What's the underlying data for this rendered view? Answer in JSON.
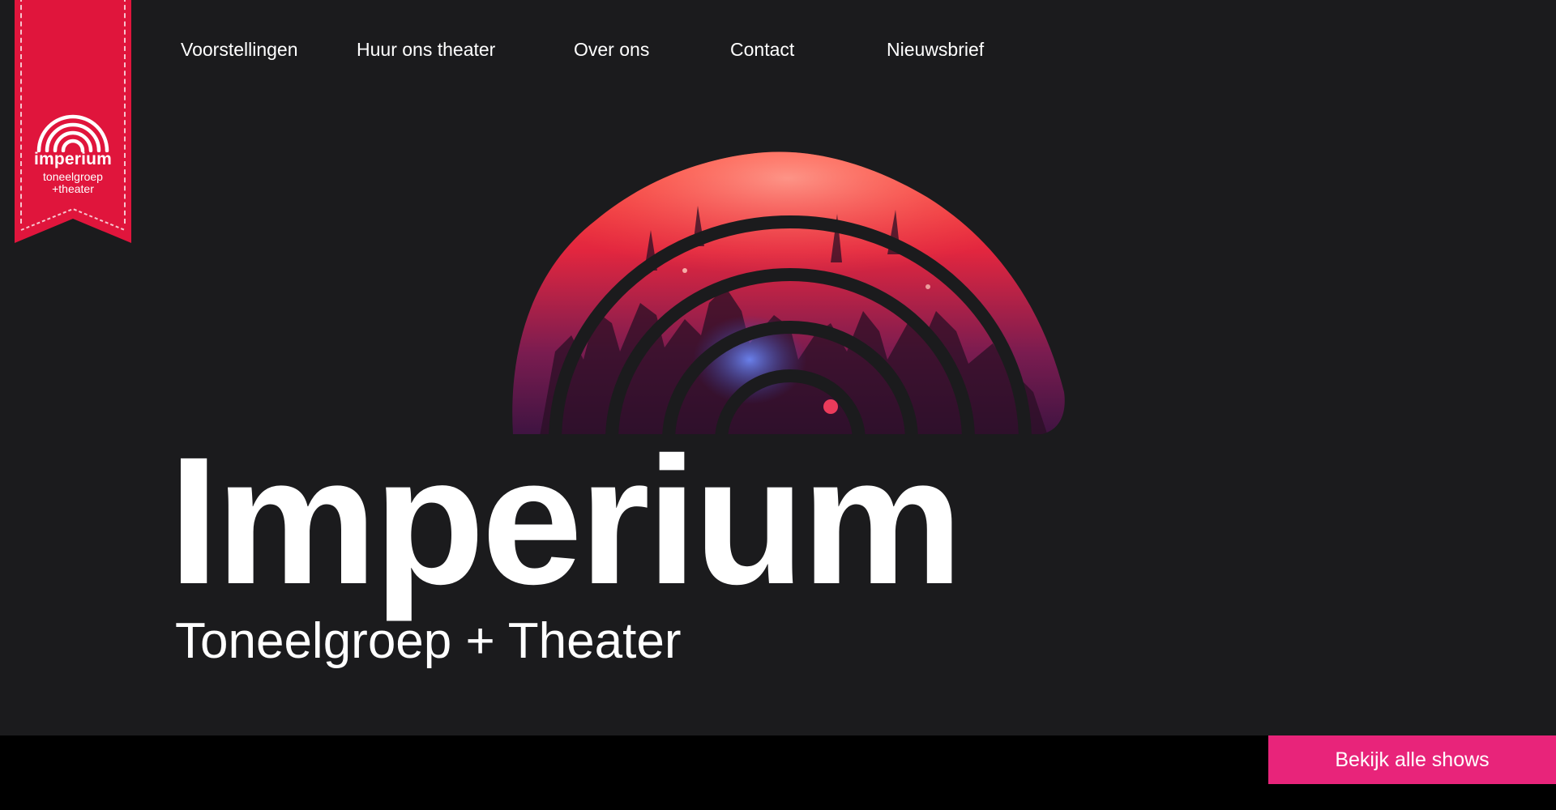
{
  "logo": {
    "wordmark": "imperium",
    "line1": "toneelgroep",
    "line2": "+theater",
    "icon": "rainbow-arcs-logo-icon",
    "color": "#e0153c"
  },
  "nav": {
    "items": [
      {
        "label": "Voorstellingen"
      },
      {
        "label": "Huur ons theater"
      },
      {
        "label": "Over ons"
      },
      {
        "label": "Contact"
      },
      {
        "label": "Nieuwsbrief"
      }
    ]
  },
  "hero": {
    "title": "Imperium",
    "subtitle": "Toneelgroep + Theater",
    "image": "concert-crowd-arc-image"
  },
  "cta": {
    "label": "Bekijk alle shows",
    "color": "#e8247a"
  },
  "colors": {
    "background": "#1b1b1d",
    "bottom_bar": "#000000",
    "accent_red": "#e0153c",
    "accent_pink": "#e8247a"
  }
}
